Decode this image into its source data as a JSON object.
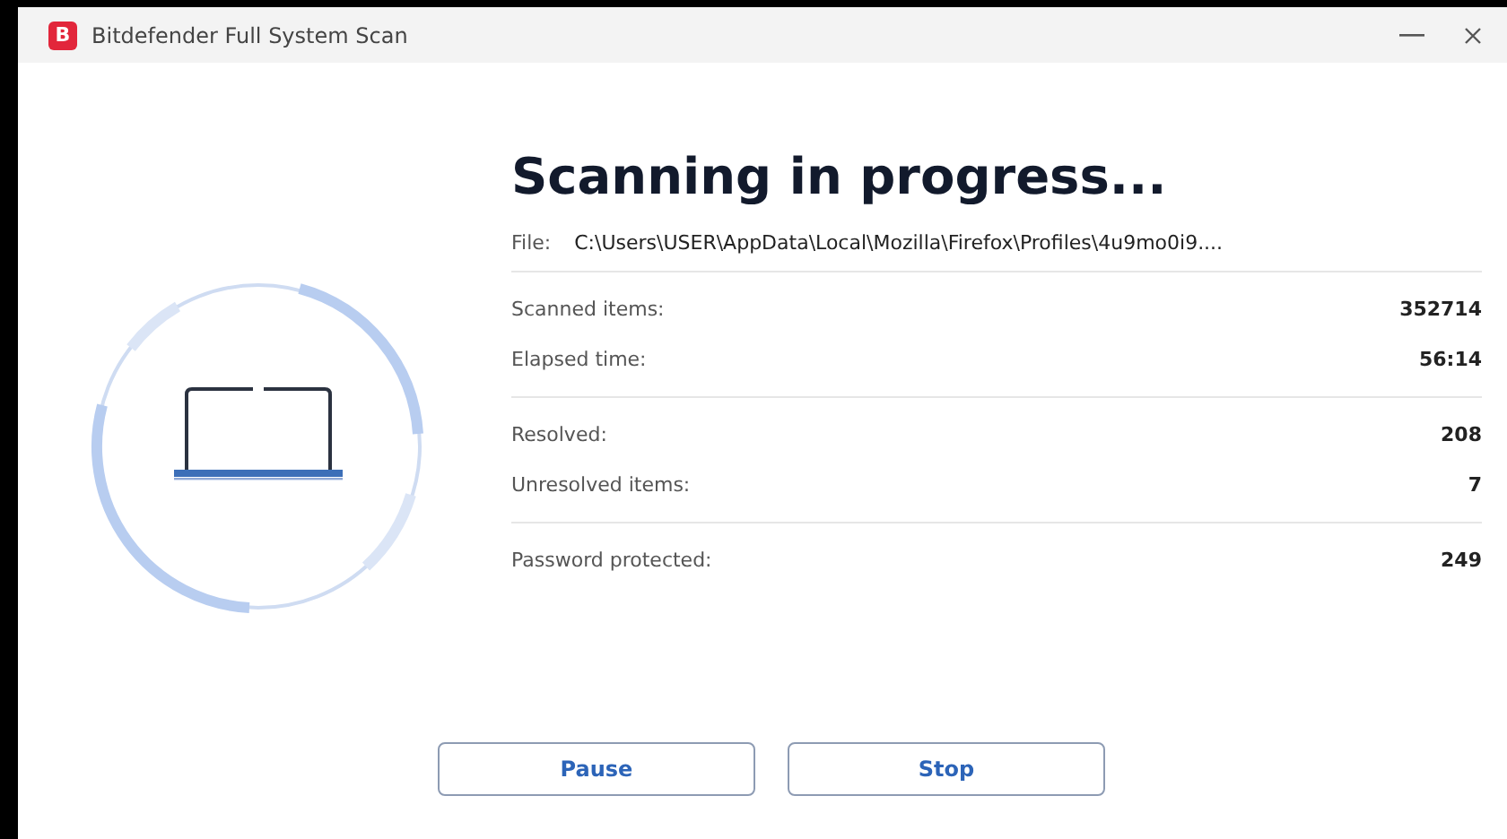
{
  "window": {
    "title": "Bitdefender Full System Scan",
    "logo": "B"
  },
  "heading": "Scanning in progress...",
  "file": {
    "label": "File:",
    "value": "C:\\Users\\USER\\AppData\\Local\\Mozilla\\Firefox\\Profiles\\4u9mo0i9...."
  },
  "stat_groups": [
    [
      {
        "label": "Scanned items:",
        "value": "352714"
      },
      {
        "label": "Elapsed time:",
        "value": "56:14"
      }
    ],
    [
      {
        "label": "Resolved:",
        "value": "208"
      },
      {
        "label": "Unresolved items:",
        "value": "7"
      }
    ],
    [
      {
        "label": "Password protected:",
        "value": "249"
      }
    ]
  ],
  "buttons": [
    "Pause",
    "Stop"
  ]
}
